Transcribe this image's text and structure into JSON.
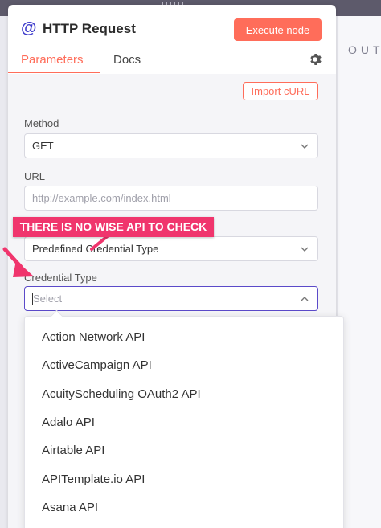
{
  "window": {
    "output_label": "OUT"
  },
  "node": {
    "title": "HTTP Request",
    "execute_label": "Execute node"
  },
  "tabs": [
    {
      "label": "Parameters",
      "active": true
    },
    {
      "label": "Docs",
      "active": false
    }
  ],
  "toolbar": {
    "import_label": "Import cURL"
  },
  "method": {
    "label": "Method",
    "value": "GET"
  },
  "url": {
    "label": "URL",
    "placeholder": "http://example.com/index.html"
  },
  "authentication": {
    "value": "Predefined Credential Type"
  },
  "credential_type": {
    "label": "Credential Type",
    "placeholder": "Select"
  },
  "dropdown": {
    "options": [
      "Action Network API",
      "ActiveCampaign API",
      "AcuityScheduling OAuth2 API",
      "Adalo API",
      "Airtable API",
      "APITemplate.io API",
      "Asana API"
    ]
  },
  "annotation": {
    "text": "THERE IS NO WISE API TO CHECK",
    "color": "#f0356d"
  },
  "colors": {
    "accent": "#ff6d5a",
    "focus": "#5b4ac9",
    "brand_icon": "#3e3ccc"
  }
}
